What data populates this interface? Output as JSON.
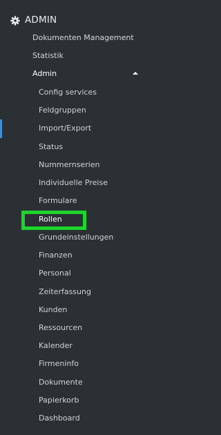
{
  "section": {
    "icon": "gear-icon",
    "title": "ADMIN"
  },
  "menu": {
    "items": [
      {
        "label": "Dokumenten Management"
      },
      {
        "label": "Statistik"
      },
      {
        "label": "Admin",
        "expanded": true
      }
    ],
    "admin_children": [
      {
        "label": "Config services"
      },
      {
        "label": "Feldgruppen"
      },
      {
        "label": "Import/Export"
      },
      {
        "label": "Status"
      },
      {
        "label": "Nummernserien"
      },
      {
        "label": "Individuelle Preise"
      },
      {
        "label": "Formulare"
      },
      {
        "label": "Rollen",
        "highlighted": true
      },
      {
        "label": "Grundeinstellungen"
      },
      {
        "label": "Finanzen"
      },
      {
        "label": "Personal"
      },
      {
        "label": "Zeiterfassung"
      },
      {
        "label": "Kunden"
      },
      {
        "label": "Ressourcen"
      },
      {
        "label": "Kalender"
      },
      {
        "label": "Firmeninfo"
      },
      {
        "label": "Dokumente"
      },
      {
        "label": "Papierkorb"
      },
      {
        "label": "Dashboard"
      }
    ]
  },
  "colors": {
    "background": "#2b3035",
    "highlight": "#1ed62b",
    "indicator": "#3d8fd6"
  }
}
